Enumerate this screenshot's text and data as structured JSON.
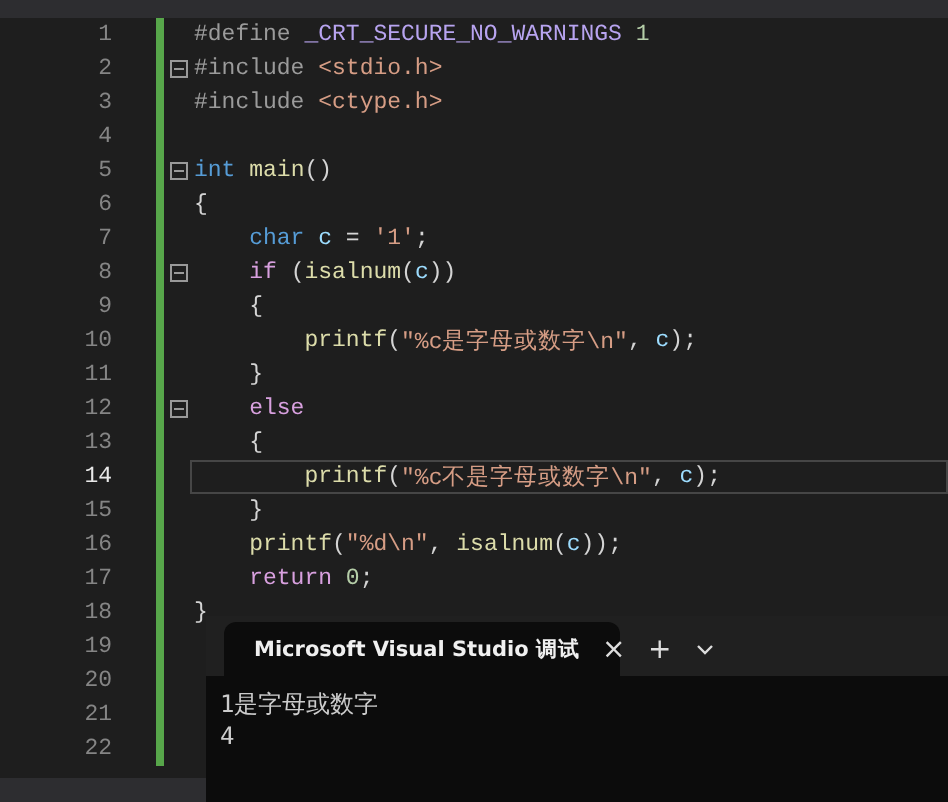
{
  "editor": {
    "lines": [
      {
        "number": "1",
        "foldable": false,
        "current": false,
        "tokens": [
          {
            "text": "#define ",
            "kind": "directive"
          },
          {
            "text": "_CRT_SECURE_NO_WARNINGS",
            "kind": "macro"
          },
          {
            "text": " 1",
            "kind": "number"
          }
        ]
      },
      {
        "number": "2",
        "foldable": true,
        "current": false,
        "tokens": [
          {
            "text": "#include ",
            "kind": "directive"
          },
          {
            "text": "<stdio.h>",
            "kind": "string"
          }
        ]
      },
      {
        "number": "3",
        "foldable": false,
        "current": false,
        "tokens": [
          {
            "text": "#include ",
            "kind": "directive"
          },
          {
            "text": "<ctype.h>",
            "kind": "string"
          }
        ]
      },
      {
        "number": "4",
        "foldable": false,
        "current": false
      },
      {
        "number": "5",
        "foldable": true,
        "current": false,
        "tokens": [
          {
            "text": "int",
            "kind": "keyword"
          },
          {
            "text": " main",
            "kind": "func"
          },
          {
            "text": "()",
            "kind": "plain"
          }
        ]
      },
      {
        "number": "6",
        "foldable": false,
        "current": false,
        "tokens": [
          {
            "text": "{",
            "kind": "plain"
          }
        ]
      },
      {
        "number": "7",
        "foldable": false,
        "current": false,
        "tokens": [
          {
            "text": "    char",
            "kind": "keyword"
          },
          {
            "text": " c",
            "kind": "var"
          },
          {
            "text": " = ",
            "kind": "plain"
          },
          {
            "text": "'1'",
            "kind": "string"
          },
          {
            "text": ";",
            "kind": "plain"
          }
        ]
      },
      {
        "number": "8",
        "foldable": true,
        "current": false,
        "tokens": [
          {
            "text": "    if",
            "kind": "control"
          },
          {
            "text": " (",
            "kind": "plain"
          },
          {
            "text": "isalnum",
            "kind": "func"
          },
          {
            "text": "(",
            "kind": "plain"
          },
          {
            "text": "c",
            "kind": "var"
          },
          {
            "text": "))",
            "kind": "plain"
          }
        ]
      },
      {
        "number": "9",
        "foldable": false,
        "current": false,
        "tokens": [
          {
            "text": "    {",
            "kind": "plain"
          }
        ]
      },
      {
        "number": "10",
        "foldable": false,
        "current": false,
        "tokens": [
          {
            "text": "        printf",
            "kind": "func"
          },
          {
            "text": "(",
            "kind": "plain"
          },
          {
            "text": "\"%c是字母或数字\\n\"",
            "kind": "string"
          },
          {
            "text": ", ",
            "kind": "plain"
          },
          {
            "text": "c",
            "kind": "var"
          },
          {
            "text": ");",
            "kind": "plain"
          }
        ]
      },
      {
        "number": "11",
        "foldable": false,
        "current": false,
        "tokens": [
          {
            "text": "    }",
            "kind": "plain"
          }
        ]
      },
      {
        "number": "12",
        "foldable": true,
        "current": false,
        "tokens": [
          {
            "text": "    else",
            "kind": "control"
          }
        ]
      },
      {
        "number": "13",
        "foldable": false,
        "current": false,
        "tokens": [
          {
            "text": "    {",
            "kind": "plain"
          }
        ]
      },
      {
        "number": "14",
        "foldable": false,
        "current": true,
        "tokens": [
          {
            "text": "        printf",
            "kind": "func"
          },
          {
            "text": "(",
            "kind": "plain"
          },
          {
            "text": "\"%c不是字母或数字\\n\"",
            "kind": "string"
          },
          {
            "text": ", ",
            "kind": "plain"
          },
          {
            "text": "c",
            "kind": "var"
          },
          {
            "text": ");",
            "kind": "plain"
          }
        ]
      },
      {
        "number": "15",
        "foldable": false,
        "current": false,
        "tokens": [
          {
            "text": "    }",
            "kind": "plain"
          }
        ]
      },
      {
        "number": "16",
        "foldable": false,
        "current": false,
        "tokens": [
          {
            "text": "    printf",
            "kind": "func"
          },
          {
            "text": "(",
            "kind": "plain"
          },
          {
            "text": "\"%d\\n\"",
            "kind": "string"
          },
          {
            "text": ", ",
            "kind": "plain"
          },
          {
            "text": "isalnum",
            "kind": "func"
          },
          {
            "text": "(",
            "kind": "plain"
          },
          {
            "text": "c",
            "kind": "var"
          },
          {
            "text": "));",
            "kind": "plain"
          }
        ]
      },
      {
        "number": "17",
        "foldable": false,
        "current": false,
        "tokens": [
          {
            "text": "    return",
            "kind": "control"
          },
          {
            "text": " 0",
            "kind": "number"
          },
          {
            "text": ";",
            "kind": "plain"
          }
        ]
      },
      {
        "number": "18",
        "foldable": false,
        "current": false,
        "tokens": [
          {
            "text": "}",
            "kind": "plain"
          }
        ]
      },
      {
        "number": "19",
        "foldable": false,
        "current": false
      },
      {
        "number": "20",
        "foldable": false,
        "current": false
      },
      {
        "number": "21",
        "foldable": false,
        "current": false
      },
      {
        "number": "22",
        "foldable": false,
        "current": false
      }
    ]
  },
  "console": {
    "tab_title": "Microsoft Visual Studio 调试",
    "close": "×",
    "new_tab": "+",
    "output": [
      "1是字母或数字",
      "4"
    ]
  }
}
